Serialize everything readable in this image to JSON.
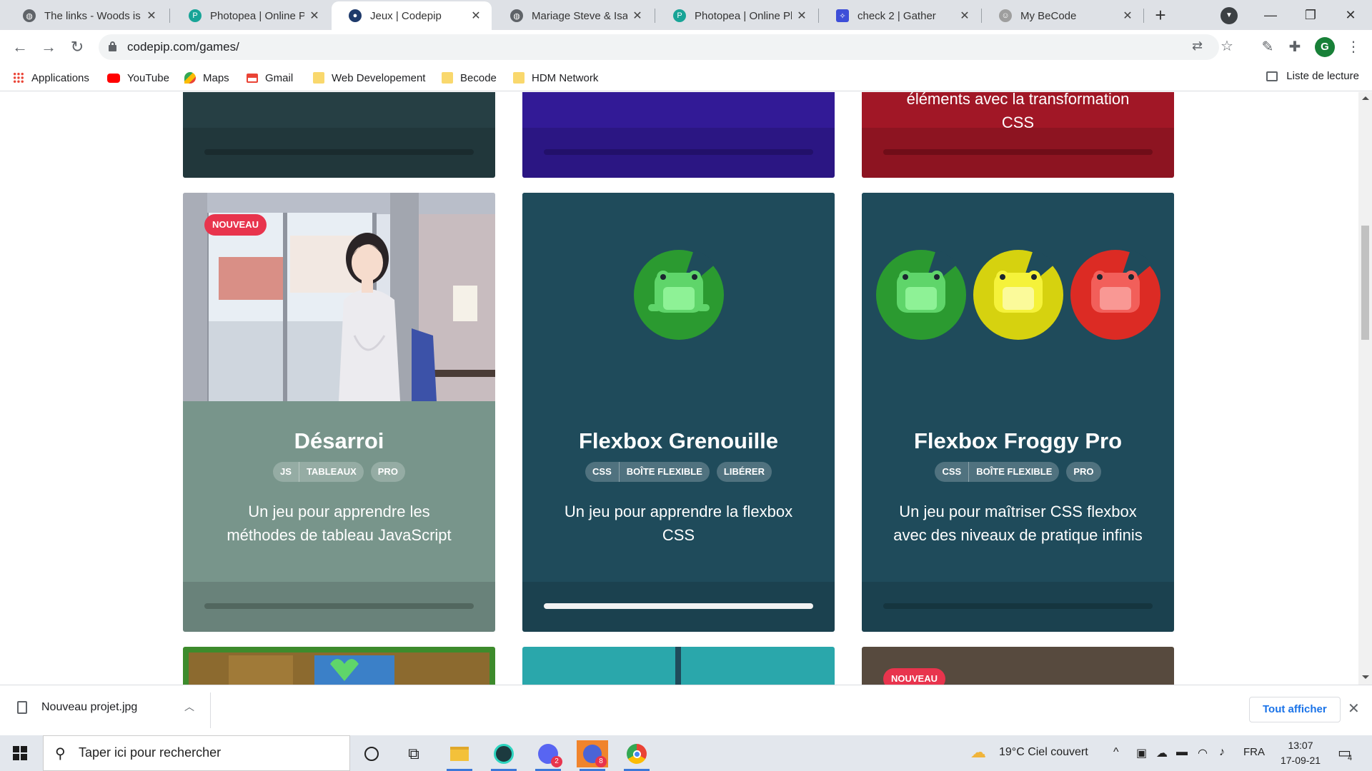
{
  "tabs": [
    {
      "label": "The links - Woods is h",
      "favicon": "globe-icon",
      "color": "#5f6368",
      "active": false
    },
    {
      "label": "Photopea | Online Pho",
      "favicon": "photopea-icon",
      "color": "#18a497",
      "active": false
    },
    {
      "label": "Jeux | Codepip",
      "favicon": "codepip-icon",
      "color": "#1e3a6b",
      "active": true
    },
    {
      "label": "Mariage Steve & Isabe",
      "favicon": "globe-icon",
      "color": "#5f6368",
      "active": false
    },
    {
      "label": "Photopea | Online Pho",
      "favicon": "photopea-icon",
      "color": "#18a497",
      "active": false
    },
    {
      "label": "check 2 | Gather",
      "favicon": "gather-icon",
      "color": "#3d4ed8",
      "active": false
    },
    {
      "label": "My BeCode",
      "favicon": "becode-icon",
      "color": "#9e9e9e",
      "active": false
    }
  ],
  "address": {
    "url": "codepip.com/games/"
  },
  "bookmarks": [
    {
      "label": "Applications",
      "icon": "apps-grid-icon",
      "color": "#ea4335"
    },
    {
      "label": "YouTube",
      "icon": "youtube-icon",
      "color": "#ff0000"
    },
    {
      "label": "Maps",
      "icon": "maps-icon",
      "color": "#34a853"
    },
    {
      "label": "Gmail",
      "icon": "gmail-icon",
      "color": "#ea4335"
    },
    {
      "label": "Web Developement",
      "icon": "folder-icon",
      "color": "#f9d86d"
    },
    {
      "label": "Becode",
      "icon": "folder-icon",
      "color": "#f9d86d"
    },
    {
      "label": "HDM Network",
      "icon": "folder-icon",
      "color": "#f9d86d"
    }
  ],
  "reading_list": "Liste de lecture",
  "top_cards": [
    {
      "bg": "#263f44",
      "bar": "#1a2b2e",
      "partial_text": ""
    },
    {
      "bg": "#321a96",
      "bar": "#22106a",
      "partial_text": ""
    },
    {
      "bg": "#a11726",
      "bar": "#700d18",
      "partial_text": "éléments avec la transformation CSS"
    }
  ],
  "cards": [
    {
      "title": "Désarroi",
      "badge": "NOUVEAU",
      "image": "anime-girl-illustration",
      "bg": "#78958b",
      "bar": "#52675f",
      "tag_groups": [
        [
          "JS",
          "TABLEAUX"
        ],
        [
          "PRO"
        ]
      ],
      "description": "Un jeu pour apprendre les méthodes de tableau JavaScript",
      "progress": 0
    },
    {
      "title": "Flexbox Grenouille",
      "badge": "",
      "image": "frog-green",
      "bg": "#1f4b5b",
      "bar": "#f2f2f2",
      "tag_groups": [
        [
          "CSS",
          "BOÎTE FLEXIBLE"
        ],
        [
          "LIBÉRER"
        ]
      ],
      "description": "Un jeu pour apprendre la flexbox CSS",
      "progress": 1
    },
    {
      "title": "Flexbox Froggy Pro",
      "badge": "",
      "image": "frogs-green-yellow-red",
      "bg": "#1f4b5b",
      "bar": "#15353f",
      "tag_groups": [
        [
          "CSS",
          "BOÎTE FLEXIBLE"
        ],
        [
          "PRO"
        ]
      ],
      "description": "Un jeu pour maîtriser CSS flexbox avec des niveaux de pratique infinis",
      "progress": 0
    }
  ],
  "bottom_cards": [
    {
      "bg": "#3d8b2c",
      "badge": ""
    },
    {
      "bg": "#2aa7ab",
      "badge": ""
    },
    {
      "bg": "#574a3e",
      "badge": "NOUVEAU"
    }
  ],
  "download": {
    "filename": "Nouveau projet.jpg",
    "show_all": "Tout afficher"
  },
  "taskbar": {
    "search_placeholder": "Taper ici pour rechercher",
    "weather": "19°C  Ciel couvert",
    "language": "FRA",
    "time": "13:07",
    "date": "17-09-21",
    "notification_count": "4",
    "discord_badge": "2",
    "app_badge": "8"
  }
}
